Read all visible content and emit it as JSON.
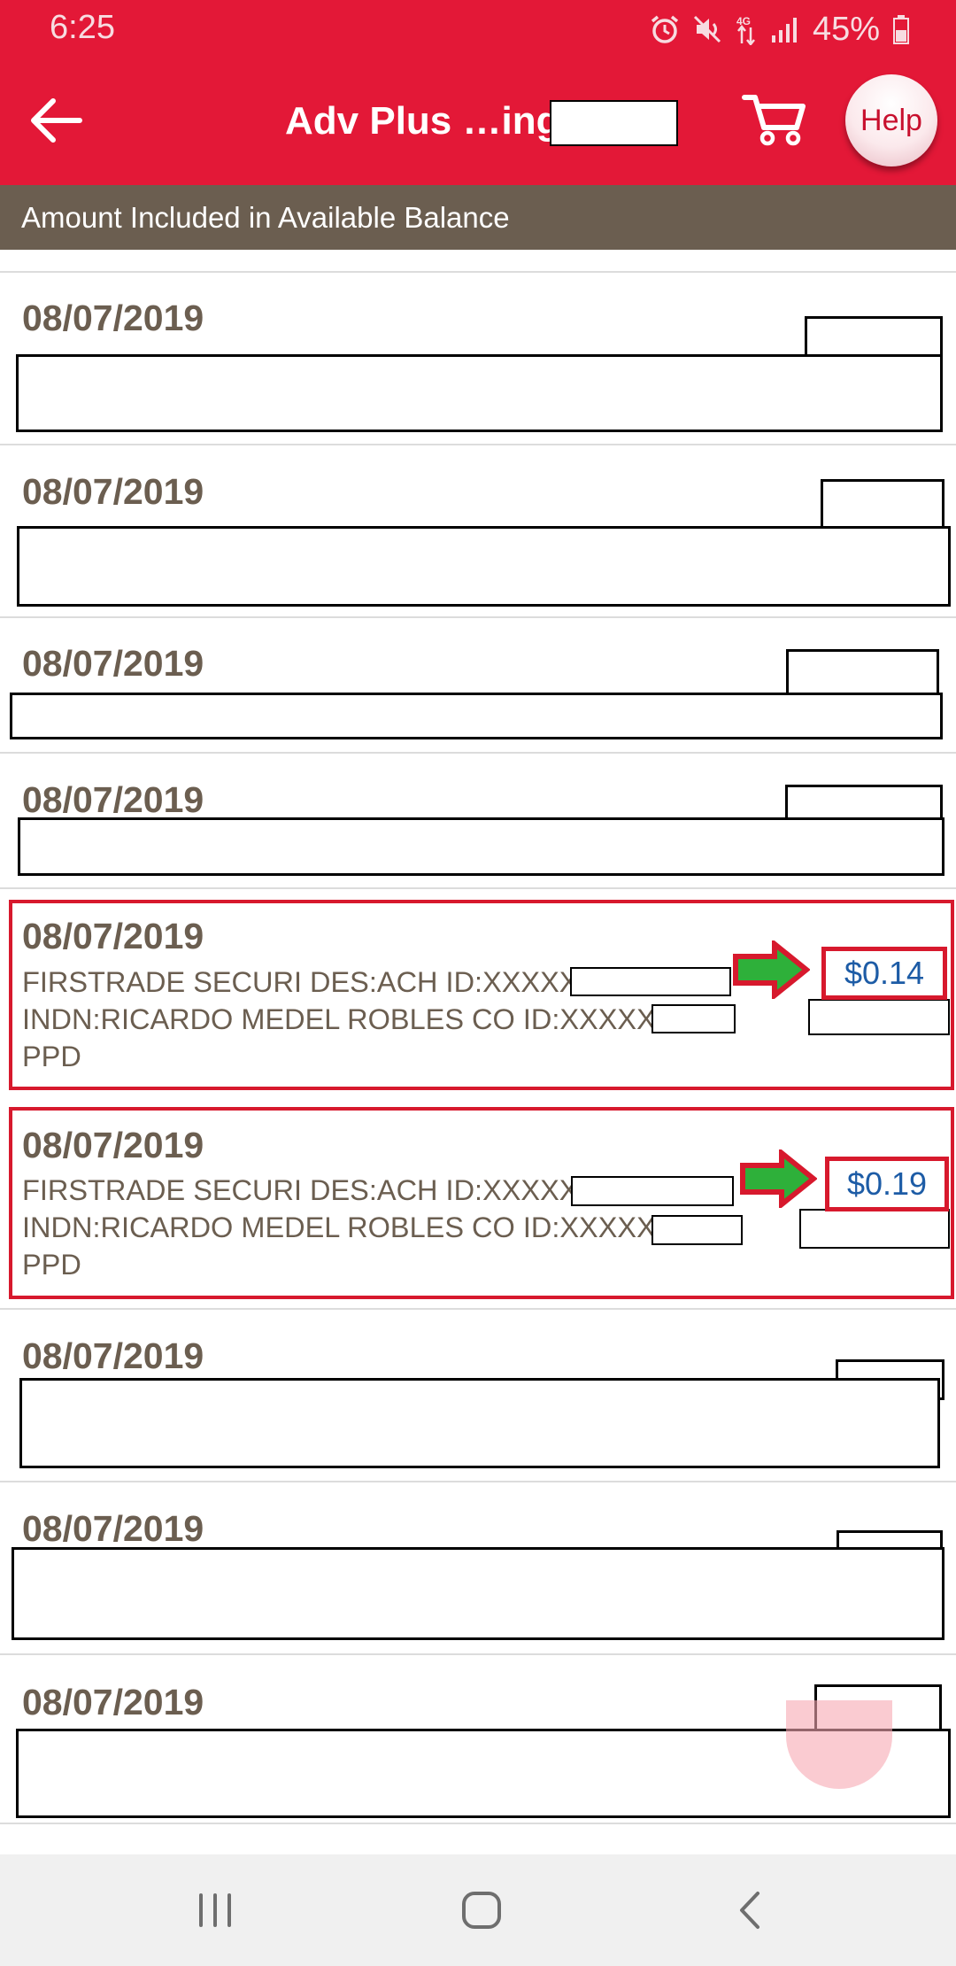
{
  "status_bar": {
    "time": "6:25",
    "battery": "45%",
    "icons": [
      "alarm-icon",
      "mute-icon",
      "data-4g-icon",
      "signal-icon",
      "battery-icon"
    ]
  },
  "header": {
    "back_icon": "arrow-left-icon",
    "title": "Adv Plus …ing",
    "cart_icon": "cart-icon",
    "help_label": "Help"
  },
  "subheader": {
    "label": "Amount Included in Available Balance"
  },
  "transactions": [
    {
      "date": "08/07/2019"
    },
    {
      "date": "08/07/2019"
    },
    {
      "date": "08/07/2019"
    },
    {
      "date": "08/07/2019"
    },
    {
      "date": "08/07/2019",
      "description": [
        "FIRSTRADE SECURI DES:ACH ID:XXXXX",
        "INDN:RICARDO MEDEL ROBLES CO ID:XXXXX",
        "PPD"
      ],
      "amount": "$0.14"
    },
    {
      "date": "08/07/2019",
      "description": [
        "FIRSTRADE SECURI DES:ACH ID:XXXXX",
        "INDN:RICARDO MEDEL ROBLES CO ID:XXXXX",
        "PPD"
      ],
      "amount": "$0.19"
    },
    {
      "date": "08/07/2019"
    },
    {
      "date": "08/07/2019"
    },
    {
      "date": "08/07/2019"
    }
  ],
  "colors": {
    "brand_red": "#e31837",
    "subheader_brown": "#6b5e50",
    "amount_blue": "#1d5ca6",
    "annotation_red": "#d7192d",
    "annotation_green": "#2eb03a"
  },
  "nav_bar": {
    "icons": [
      "recent-apps-icon",
      "home-icon",
      "back-icon"
    ]
  }
}
